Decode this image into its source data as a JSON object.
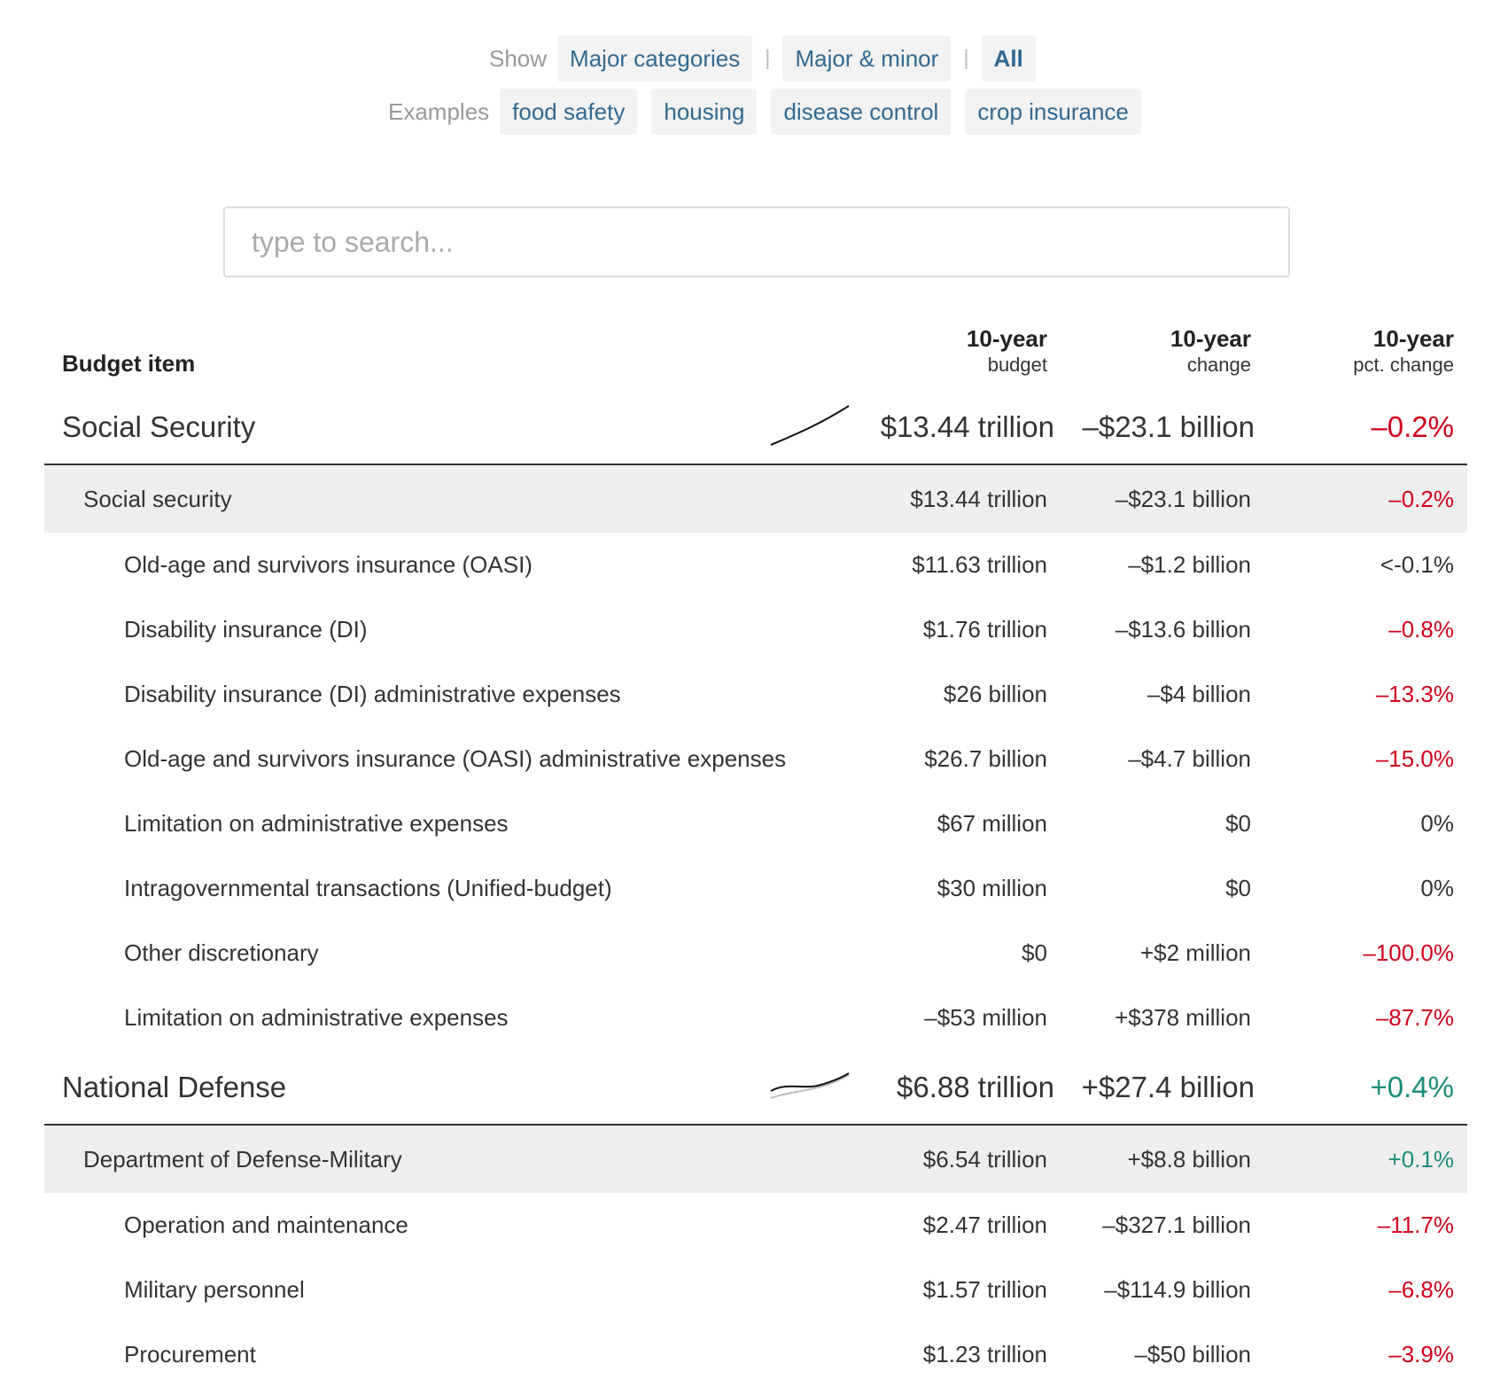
{
  "filters": {
    "show_label": "Show",
    "show_options": [
      "Major categories",
      "Major & minor",
      "All"
    ],
    "active_option": "All",
    "examples_label": "Examples",
    "examples": [
      "food safety",
      "housing",
      "disease control",
      "crop insurance"
    ]
  },
  "search": {
    "placeholder": "type to search..."
  },
  "table": {
    "headers": {
      "item": "Budget item",
      "budget_l1": "10-year",
      "budget_l2": "budget",
      "change_l1": "10-year",
      "change_l2": "change",
      "pct_l1": "10-year",
      "pct_l2": "pct. change"
    },
    "sections": [
      {
        "name": "Social Security",
        "budget": "$13.44 trillion",
        "change": "–$23.1 billion",
        "pct": "–0.2%",
        "pct_sign": "neg",
        "sub": {
          "name": "Social security",
          "budget": "$13.44 trillion",
          "change": "–$23.1 billion",
          "pct": "–0.2%",
          "pct_sign": "neg"
        },
        "items": [
          {
            "name": "Old-age and survivors insurance (OASI)",
            "budget": "$11.63 trillion",
            "change": "–$1.2 billion",
            "pct": "<-0.1%",
            "pct_sign": "zero"
          },
          {
            "name": "Disability insurance (DI)",
            "budget": "$1.76 trillion",
            "change": "–$13.6 billion",
            "pct": "–0.8%",
            "pct_sign": "neg"
          },
          {
            "name": "Disability insurance (DI) administrative expenses",
            "budget": "$26 billion",
            "change": "–$4 billion",
            "pct": "–13.3%",
            "pct_sign": "neg"
          },
          {
            "name": "Old-age and survivors insurance (OASI) administrative expenses",
            "budget": "$26.7 billion",
            "change": "–$4.7 billion",
            "pct": "–15.0%",
            "pct_sign": "neg"
          },
          {
            "name": "Limitation on administrative expenses",
            "budget": "$67 million",
            "change": "$0",
            "pct": "0%",
            "pct_sign": "zero"
          },
          {
            "name": "Intragovernmental transactions (Unified-budget)",
            "budget": "$30 million",
            "change": "$0",
            "pct": "0%",
            "pct_sign": "zero"
          },
          {
            "name": "Other discretionary",
            "budget": "$0",
            "change": "+$2 million",
            "pct": "–100.0%",
            "pct_sign": "neg"
          },
          {
            "name": "Limitation on administrative expenses",
            "budget": "–$53 million",
            "change": "+$378 million",
            "pct": "–87.7%",
            "pct_sign": "neg"
          }
        ]
      },
      {
        "name": "National Defense",
        "budget": "$6.88 trillion",
        "change": "+$27.4 billion",
        "pct": "+0.4%",
        "pct_sign": "pos",
        "sub": {
          "name": "Department of Defense-Military",
          "budget": "$6.54 trillion",
          "change": "+$8.8 billion",
          "pct": "+0.1%",
          "pct_sign": "pos"
        },
        "items": [
          {
            "name": "Operation and maintenance",
            "budget": "$2.47 trillion",
            "change": "–$327.1 billion",
            "pct": "–11.7%",
            "pct_sign": "neg"
          },
          {
            "name": "Military personnel",
            "budget": "$1.57 trillion",
            "change": "–$114.9 billion",
            "pct": "–6.8%",
            "pct_sign": "neg"
          },
          {
            "name": "Procurement",
            "budget": "$1.23 trillion",
            "change": "–$50 billion",
            "pct": "–3.9%",
            "pct_sign": "neg"
          }
        ]
      }
    ]
  },
  "colors": {
    "link": "#326891",
    "negative": "#d0021b",
    "positive": "#1a8d7a",
    "band": "#eeeeee"
  }
}
